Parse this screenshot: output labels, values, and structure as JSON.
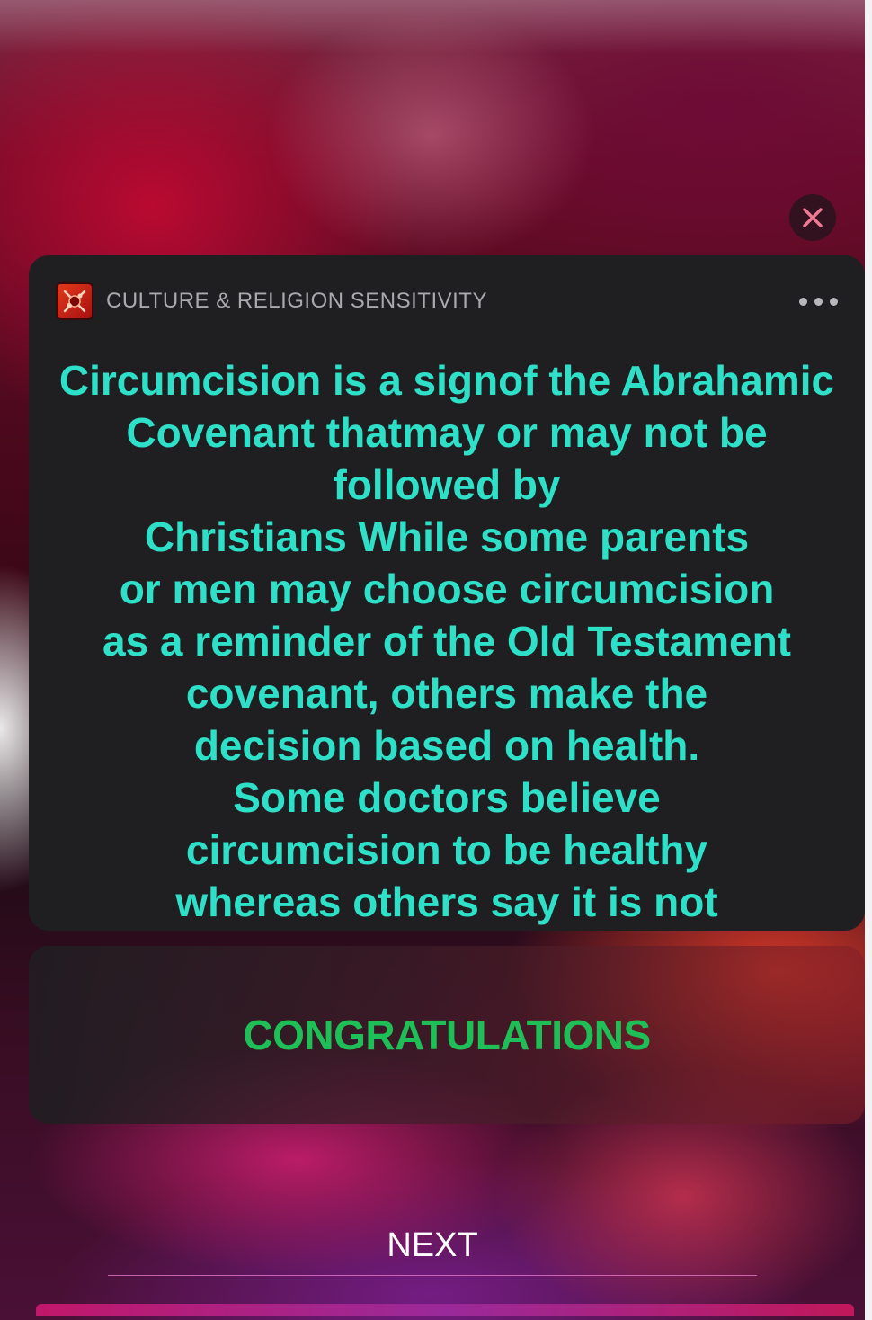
{
  "notification": {
    "app_name": "CULTURE & RELIGION SENSITIVITY",
    "app_icon": "culture-religion-app-icon",
    "more_icon": "more-horizontal-icon",
    "message": "Circumcision is a signof the Abrahamic\nCovenant thatmay or may not be\nfollowed by\nChristians  While some parents\nor men may choose circumcision\nas a reminder of the Old Testament\ncovenant, others make the\ndecision based on health.\nSome doctors believe\ncircumcision to be healthy\nwhereas others say it is not"
  },
  "close_icon": "close-icon",
  "result": {
    "label": "CONGRATULATIONS"
  },
  "next_button": {
    "label": "NEXT"
  },
  "colors": {
    "message_text": "#2fe0c8",
    "congrats_text": "#1fbf57",
    "card_bg": "#1f1f21",
    "close_x": "#f07a96"
  }
}
